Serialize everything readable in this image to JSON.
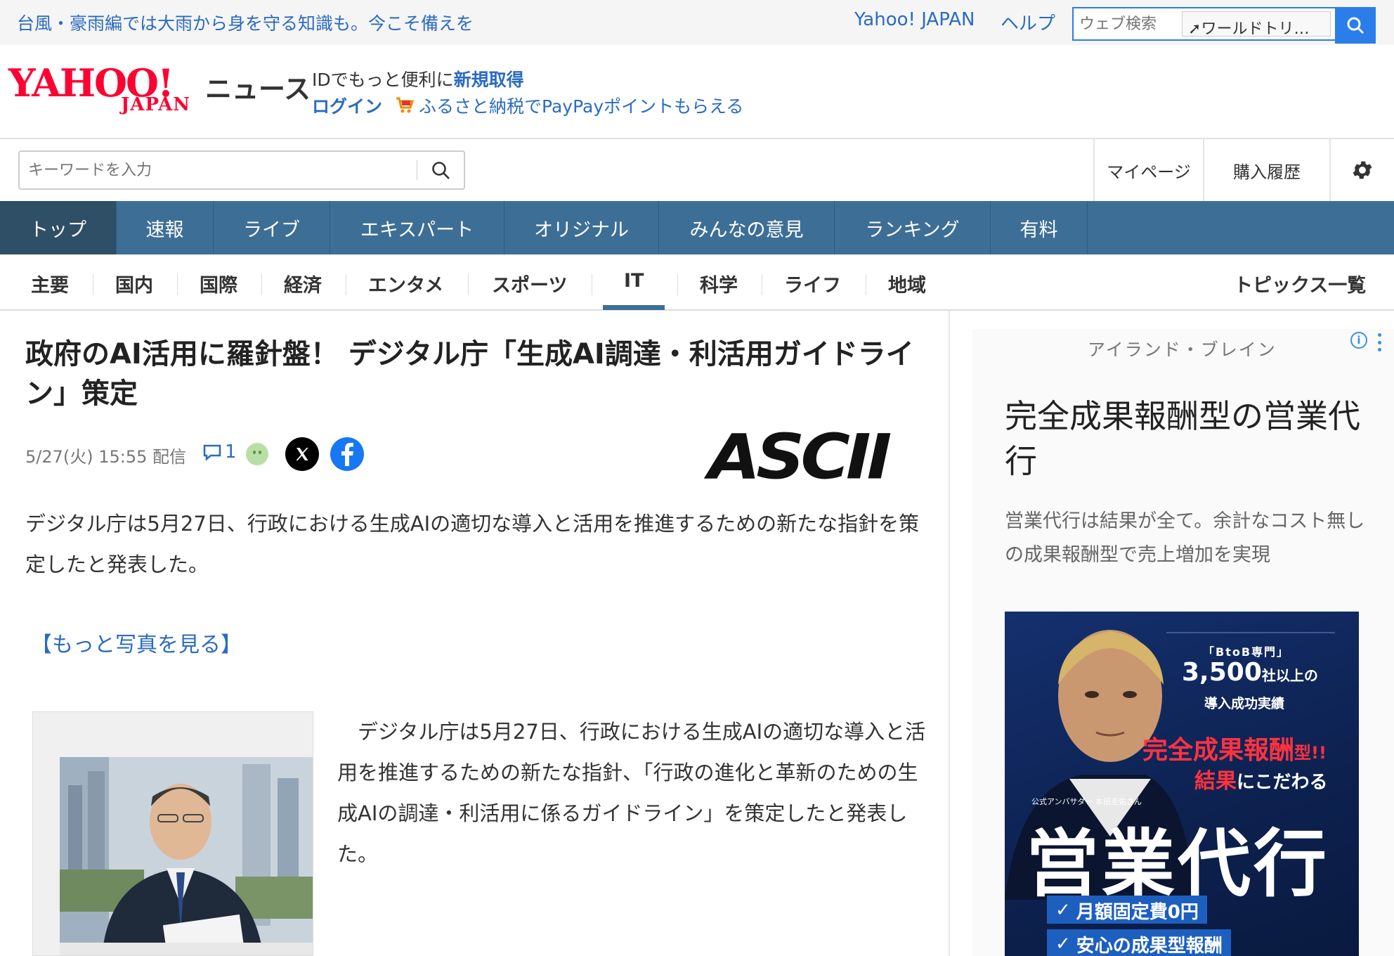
{
  "topbar": {
    "alert": "台風・豪雨編では大雨から身を守る知識も。今こそ備えを",
    "yahoo_japan": "Yahoo! JAPAN",
    "help": "ヘルプ",
    "web_search_placeholder": "ウェブ検索",
    "trend_label": "ワールドトリ…"
  },
  "header": {
    "logo_yahoo": "YAHOO!",
    "logo_japan": "JAPAN",
    "news_label": "ニュース",
    "id_prefix": "IDでもっと便利に",
    "id_signup": "新規取得",
    "login": "ログイン",
    "furusato": "ふるさと納税でPayPayポイントもらえる"
  },
  "search": {
    "placeholder": "キーワードを入力"
  },
  "utility": {
    "mypage": "マイページ",
    "purchase_history": "購入履歴"
  },
  "main_nav": [
    "トップ",
    "速報",
    "ライブ",
    "エキスパート",
    "オリジナル",
    "みんなの意見",
    "ランキング",
    "有料"
  ],
  "sub_nav": [
    "主要",
    "国内",
    "国際",
    "経済",
    "エンタメ",
    "スポーツ",
    "IT",
    "科学",
    "ライフ",
    "地域"
  ],
  "topics_all": "トピックス一覧",
  "article": {
    "headline": "政府のAI活用に羅針盤！ デジタル庁「生成AI調達・利活用ガイドライン」策定",
    "date": "5/27(火) 15:55 配信",
    "comment_count": "1",
    "source_logo": "ASCII",
    "lead": "デジタル庁は5月27日、行政における生成AIの適切な導入と活用を推進するための新たな指針を策定したと発表した。",
    "more_photos": "【もっと写真を見る】",
    "body": "デジタル庁は5月27日、行政における生成AIの適切な導入と活用を推進するための新たな指針、「行政の進化と革新のための生成AIの調達・利活用に係るガイドライン」を策定したと発表した。"
  },
  "ad": {
    "brand": "アイランド・ブレイン",
    "title": "完全成果報酬型の営業代行",
    "description": "営業代行は結果が全て。余計なコスト無しの成果報酬型で売上増加を実現",
    "banner": {
      "btob": "「BtoB専門」",
      "count": "3,500",
      "count_suffix": "社以上の",
      "record": "導入成功実績",
      "red1": "完全成果報酬",
      "red1_suffix": "型!!",
      "red2": "結果",
      "red2_suffix": "にこだわる",
      "caption": "公式アンバサダー 本田圭佑さん",
      "big": "営業代行",
      "chip1": "月額固定費0円",
      "chip2": "安心の成果型報酬"
    }
  },
  "colors": {
    "link_blue": "#2b6bc0",
    "nav_blue": "#3d6f96",
    "nav_active": "#2f4f66",
    "yahoo_red": "#ff0033"
  }
}
